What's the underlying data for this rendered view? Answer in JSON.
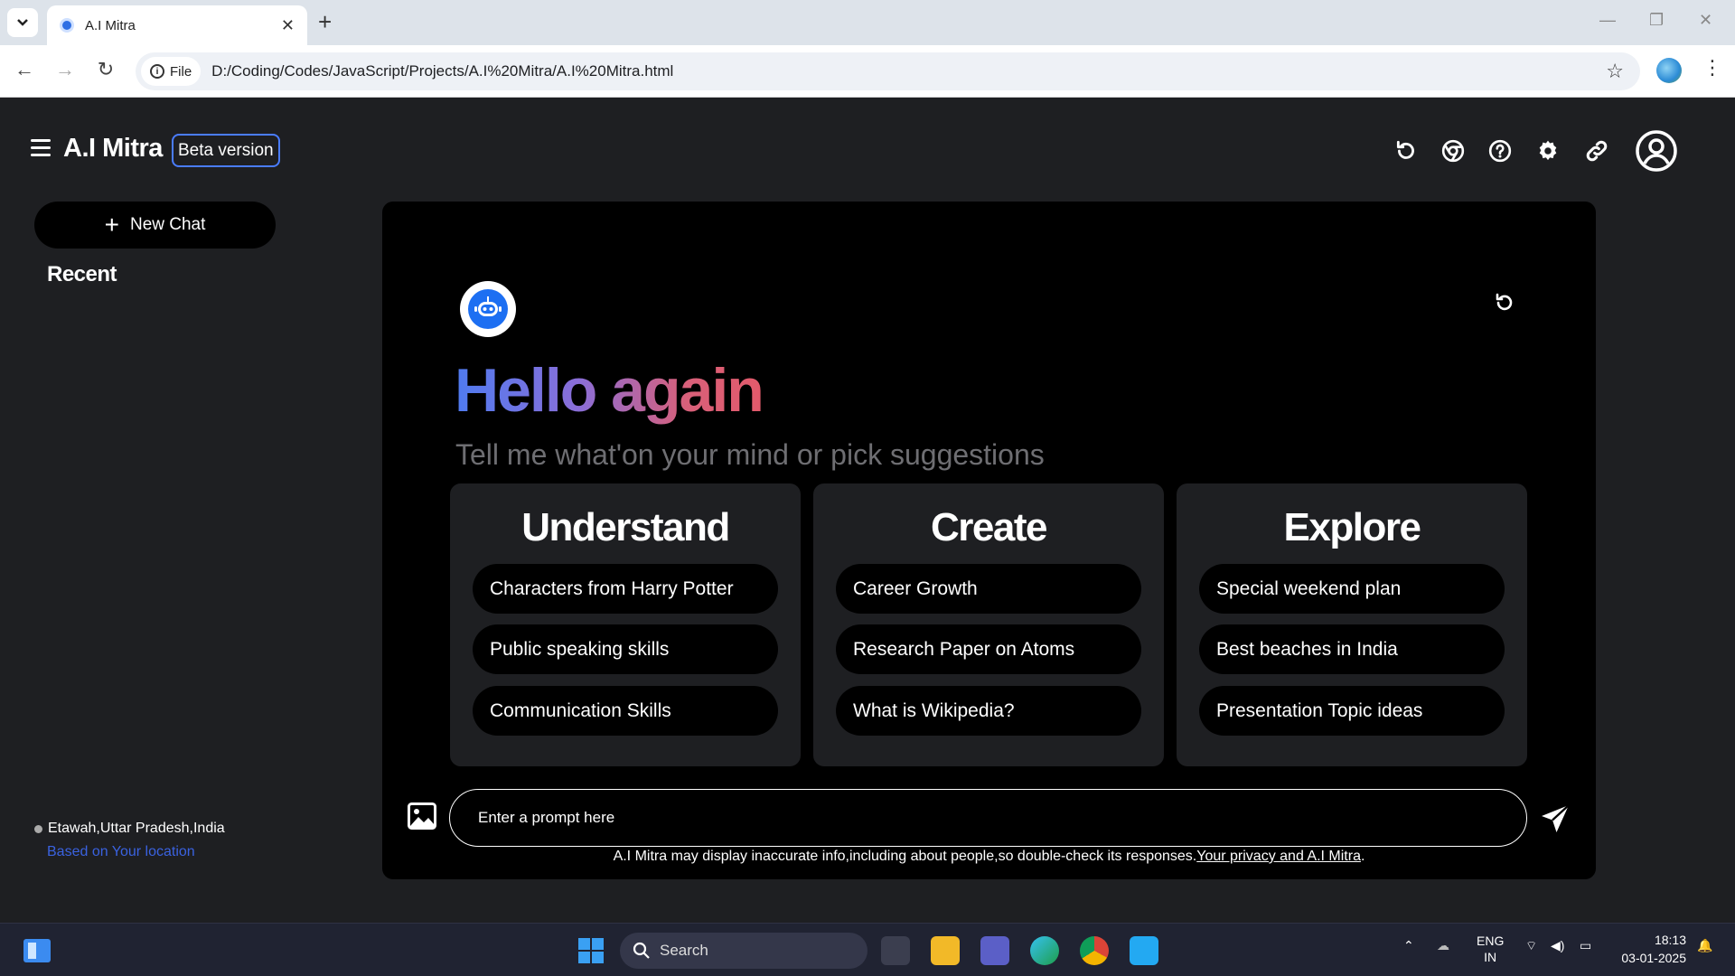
{
  "browser": {
    "tab_title": "A.I Mitra",
    "chip_label": "File",
    "url": "D:/Coding/Codes/JavaScript/Projects/A.I%20Mitra/A.I%20Mitra.html"
  },
  "header": {
    "brand": "A.I Mitra",
    "badge": "Beta version",
    "icons": [
      "refresh-icon",
      "chrome-icon",
      "help-icon",
      "settings-icon",
      "link-icon",
      "account-icon"
    ]
  },
  "sidebar": {
    "new_chat_label": "New Chat",
    "recent_label": "Recent",
    "location": "Etawah,Uttar Pradesh,India",
    "location_note": "Based on Your location"
  },
  "main": {
    "greeting_hello": "Hello again",
    "subtitle": "Tell me what'on your mind or pick suggestions",
    "cards": [
      {
        "title": "Understand",
        "items": [
          "Characters from Harry Potter",
          "Public speaking skills",
          "Communication Skills"
        ]
      },
      {
        "title": "Create",
        "items": [
          "Career Growth",
          "Research Paper on Atoms",
          "What is Wikipedia?"
        ]
      },
      {
        "title": "Explore",
        "items": [
          "Special weekend plan",
          "Best beaches in India",
          "Presentation Topic ideas"
        ]
      }
    ],
    "prompt_placeholder": "Enter a prompt here",
    "disclaimer_text": "A.I Mitra may display inaccurate info,including about people,so double-check its responses.",
    "disclaimer_link": "Your privacy and A.I Mitra",
    "disclaimer_end": "."
  },
  "taskbar": {
    "search_label": "Search",
    "lang_top": "ENG",
    "lang_bottom": "IN",
    "time": "18:13",
    "date": "03-01-2025"
  },
  "colors": {
    "accent_blue": "#4a7cff",
    "panel_bg": "#000000",
    "app_bg": "#1e1f22",
    "link_blue": "#3a62e0"
  }
}
